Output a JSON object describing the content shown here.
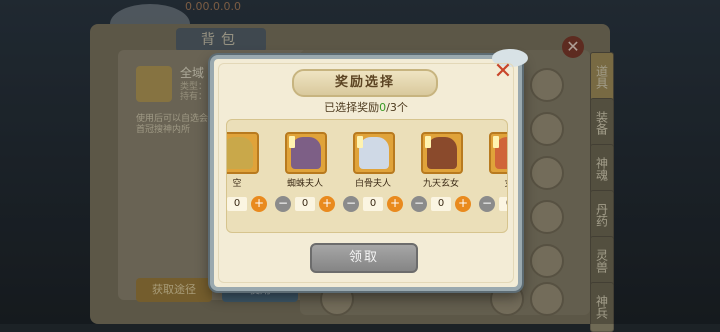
{
  "background": {
    "bag_tab": "背包",
    "top_text": "0.00.0.0.0",
    "item_name": "全域",
    "item_meta": [
      "类型：",
      "持有："
    ],
    "item_desc": "使用后可以自选会首冠搜神内所",
    "btn_left": "获取途径",
    "btn_right": "使用",
    "side_tabs": [
      "道具",
      "装备",
      "神魂",
      "丹药",
      "灵兽",
      "神兵"
    ],
    "close_glyph": "✕"
  },
  "modal": {
    "title": "奖励选择",
    "close_icon": "✕",
    "count_prefix": "已选择奖励",
    "count_selected": "0",
    "count_total": "/3个",
    "claim_label": "领取",
    "rewards": [
      {
        "name": "空",
        "qty": "0",
        "minus": "−",
        "plus": "+",
        "icon": "partial-hero-portrait"
      },
      {
        "name": "蜘蛛夫人",
        "qty": "0",
        "minus": "−",
        "plus": "+",
        "icon": "spider-lady-portrait"
      },
      {
        "name": "白骨夫人",
        "qty": "0",
        "minus": "−",
        "plus": "+",
        "icon": "bone-lady-portrait"
      },
      {
        "name": "九天玄女",
        "qty": "0",
        "minus": "−",
        "plus": "+",
        "icon": "celestial-maiden-portrait"
      },
      {
        "name": "女",
        "qty": "0",
        "minus": "−",
        "plus": "+",
        "icon": "partial-hero-portrait"
      }
    ]
  },
  "colors": {
    "accent_orange": "#e98a1e",
    "selected_green": "#3a9a26",
    "close_red": "#c8452a",
    "panel_cream": "#f3ecd6"
  }
}
